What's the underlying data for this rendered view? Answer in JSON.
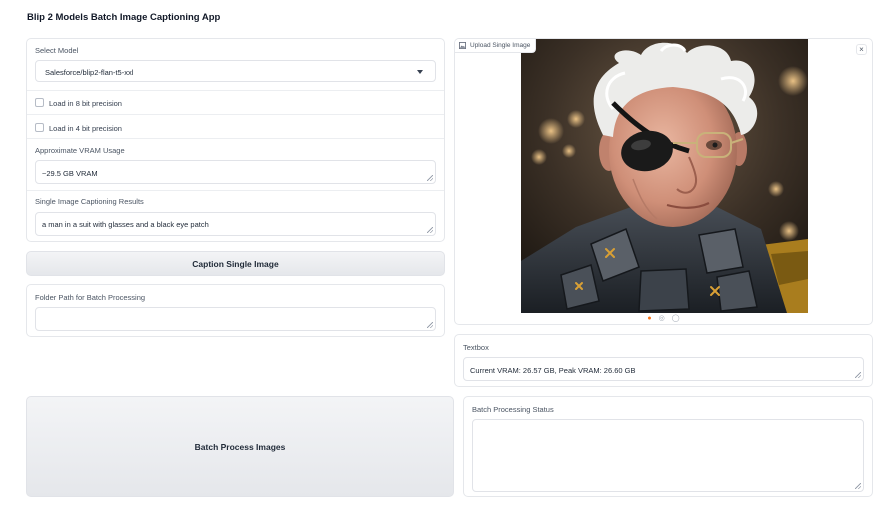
{
  "app": {
    "title": "Blip 2 Models Batch Image Captioning App"
  },
  "model": {
    "label": "Select Model",
    "selected": "Salesforce/blip2-flan-t5-xxl"
  },
  "options": {
    "load_8bit": {
      "label": "Load in 8 bit precision",
      "checked": false
    },
    "load_4bit": {
      "label": "Load in 4 bit precision",
      "checked": false
    }
  },
  "vram": {
    "label": "Approximate VRAM Usage",
    "value": "~29.5 GB VRAM"
  },
  "single_result": {
    "label": "Single Image Captioning Results",
    "value": "a man in a suit with glasses and a black eye patch"
  },
  "caption_button": {
    "label": "Caption Single Image"
  },
  "folder": {
    "label": "Folder Path for Batch Processing",
    "value": ""
  },
  "batch_button": {
    "label": "Batch Process Images"
  },
  "upload": {
    "label": "Upload Single Image",
    "clear": "×"
  },
  "carousel": {
    "dots": [
      "●",
      "◎",
      "◯"
    ]
  },
  "vram_status": {
    "label": "Textbox",
    "value": "Current VRAM: 26.57 GB, Peak VRAM: 26.60 GB"
  },
  "batch_status": {
    "label": "Batch Processing Status",
    "value": ""
  },
  "colors": {
    "accent": "#f97316",
    "border": "#e5e7eb",
    "button": "#e5e7eb"
  }
}
